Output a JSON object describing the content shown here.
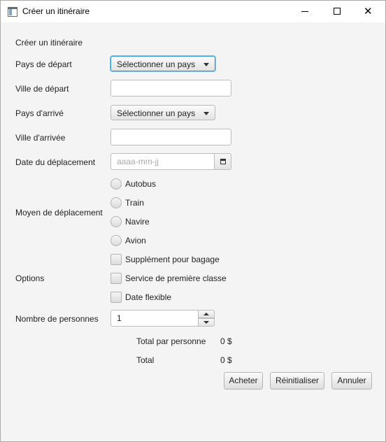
{
  "window": {
    "title": "Créer un itinéraire"
  },
  "form": {
    "heading": "Créer un itinéraire",
    "departure_country": {
      "label": "Pays de départ",
      "value": "Sélectionner un pays"
    },
    "departure_city": {
      "label": "Ville de départ",
      "value": ""
    },
    "arrival_country": {
      "label": "Pays d'arrivé",
      "value": "Sélectionner un pays"
    },
    "arrival_city": {
      "label": "Ville d'arrivée",
      "value": ""
    },
    "travel_date": {
      "label": "Date du déplacement",
      "placeholder": "aaaa-mm-jj",
      "icon": "calendar-icon"
    },
    "transport": {
      "label": "Moyen de déplacement",
      "options": [
        "Autobus",
        "Train",
        "Navire",
        "Avion"
      ]
    },
    "options": {
      "label": "Options",
      "items": [
        "Supplément pour bagage",
        "Service de première classe",
        "Date flexible"
      ]
    },
    "persons": {
      "label": "Nombre de personnes",
      "value": "1"
    },
    "total_per_person": {
      "label": "Total par personne",
      "value": "0 $"
    },
    "total": {
      "label": "Total",
      "value": "0 $"
    }
  },
  "buttons": {
    "buy": "Acheter",
    "reset": "Réinitialiser",
    "cancel": "Annuler"
  },
  "colors": {
    "focus_accent": "#2b9ad6",
    "window_bg": "#f4f4f4"
  }
}
